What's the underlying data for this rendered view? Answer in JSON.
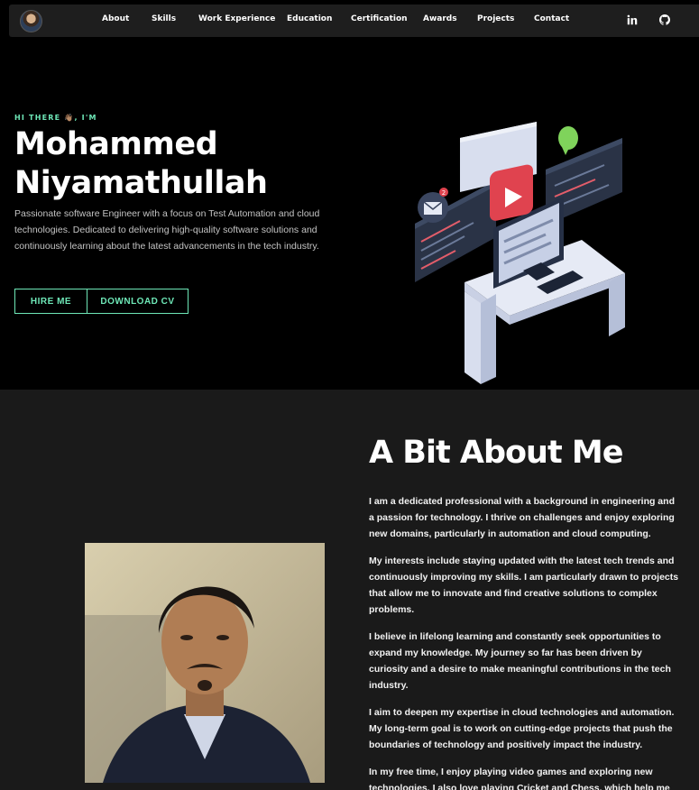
{
  "nav": {
    "links": [
      "About",
      "Skills",
      "Work Experience",
      "Education",
      "Certification",
      "Awards",
      "Projects",
      "Contact"
    ],
    "social_icons": [
      "linkedin-icon",
      "github-icon"
    ]
  },
  "hero": {
    "greeting": "HI THERE 👋🏽, I'M",
    "name": "Mohammed Niyamathullah",
    "description": "Passionate software Engineer with a focus on Test Automation and cloud technologies. Dedicated to delivering high-quality software solutions and continuously learning about the latest advancements in the tech industry.",
    "hire_button": "HIRE ME",
    "cv_button": "DOWNLOAD CV",
    "illustration_badge": "2",
    "accent_color": "#6ee7b7"
  },
  "about": {
    "title": "A Bit About Me",
    "paragraphs": [
      "I am a dedicated professional with a background in engineering and a passion for technology. I thrive on challenges and enjoy exploring new domains, particularly in automation and cloud computing.",
      "My interests include staying updated with the latest tech trends and continuously improving my skills. I am particularly drawn to projects that allow me to innovate and find creative solutions to complex problems.",
      "I believe in lifelong learning and constantly seek opportunities to expand my knowledge. My journey so far has been driven by curiosity and a desire to make meaningful contributions in the tech industry.",
      "I aim to deepen my expertise in cloud technologies and automation. My long-term goal is to work on cutting-edge projects that push the boundaries of technology and positively impact the industry.",
      "In my free time, I enjoy playing video games and exploring new technologies. I also love playing Cricket and Chess, which help me unwind and recharge."
    ]
  }
}
